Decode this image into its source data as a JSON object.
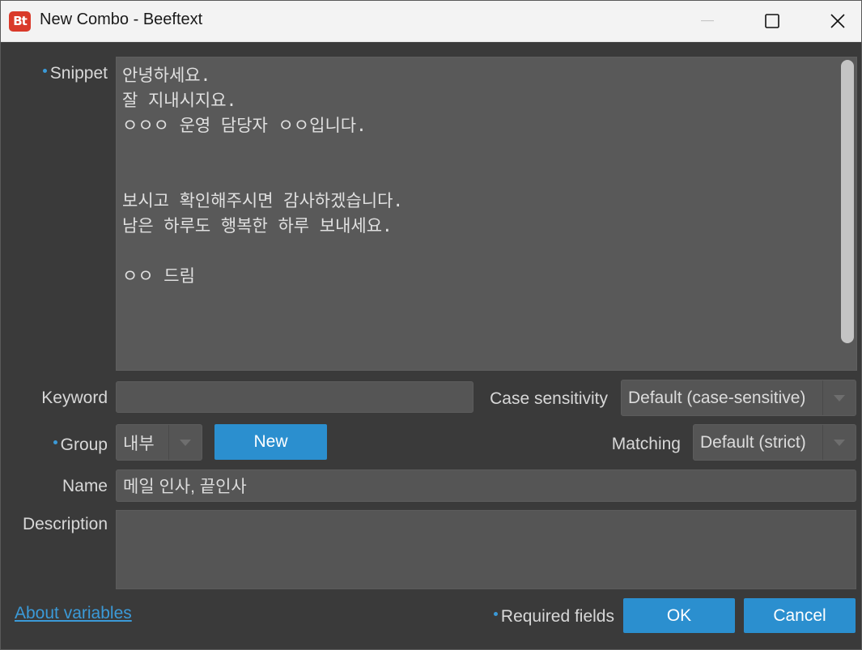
{
  "window": {
    "title": "New Combo - Beeftext",
    "logo_text": "Bt",
    "controls": [
      "minimize-icon",
      "maximize-icon",
      "close-icon"
    ]
  },
  "form": {
    "snippet": {
      "label": "Snippet",
      "required": true,
      "value": "안녕하세요.\n잘 지내시지요.\nㅇㅇㅇ 운영 담당자 ㅇㅇ입니다.\n\n\n보시고 확인해주시면 감사하겠습니다.\n남은 하루도 행복한 하루 보내세요.\n\nㅇㅇ 드림"
    },
    "keyword": {
      "label": "Keyword",
      "value": ""
    },
    "case_sensitivity": {
      "label": "Case sensitivity",
      "selected": "Default (case-sensitive)"
    },
    "group": {
      "label": "Group",
      "required": true,
      "selected": "내부",
      "new_button": "New"
    },
    "matching": {
      "label": "Matching",
      "selected": "Default (strict)"
    },
    "name": {
      "label": "Name",
      "value": "메일 인사, 끝인사"
    },
    "description": {
      "label": "Description",
      "value": ""
    }
  },
  "footer": {
    "about_variables_link": "About variables",
    "required_fields_note": "Required fields",
    "ok_button": "OK",
    "cancel_button": "Cancel"
  },
  "colors": {
    "accent": "#2b8fcf",
    "required_dot": "#3b9ad8",
    "background": "#3a3a3a",
    "field": "#555555",
    "logo": "#d93a2a"
  }
}
